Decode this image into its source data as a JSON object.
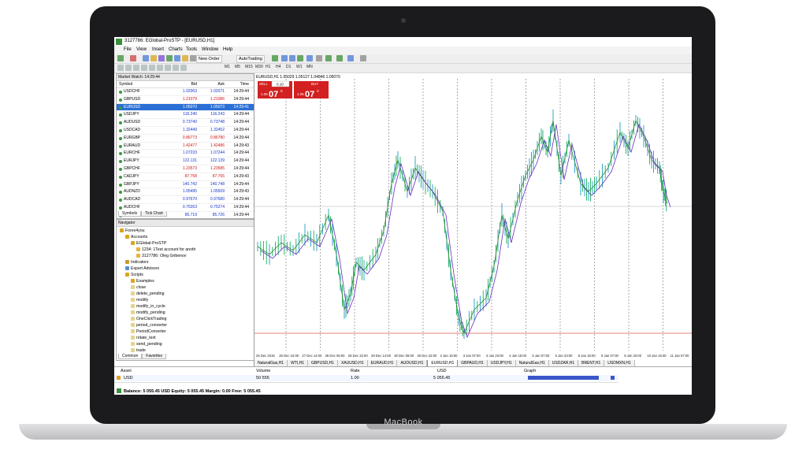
{
  "device": {
    "label": "MacBook"
  },
  "window": {
    "title": "3127786: EGlobal-ProSTP - [EURUSD,H1]"
  },
  "menu": [
    "File",
    "View",
    "Insert",
    "Charts",
    "Tools",
    "Window",
    "Help"
  ],
  "toolbar": {
    "new_order": "New Order",
    "autotrading": "AutoTrading"
  },
  "timeframes": [
    "M1",
    "M5",
    "M15",
    "M30",
    "H1",
    "H4",
    "D1",
    "W1",
    "MN"
  ],
  "market_watch": {
    "title": "Market Watch: 14:29:44",
    "columns": {
      "symbol": "Symbol",
      "bid": "Bid",
      "ask": "Ask",
      "time": "Time"
    },
    "rows": [
      {
        "symbol": "USDCHF",
        "bid": "1.02063",
        "ask": "1.02071",
        "time": "14:29:44",
        "color": "c-b"
      },
      {
        "symbol": "GBPUSD",
        "bid": "1.21079",
        "ask": "1.21086",
        "time": "14:29:44",
        "color": "c-r"
      },
      {
        "symbol": "EURUSD",
        "bid": "1.05070",
        "ask": "1.05073",
        "time": "14:29:41",
        "color": "c-b"
      },
      {
        "symbol": "USDJPY",
        "bid": "116.240",
        "ask": "116.243",
        "time": "14:29:44",
        "color": "c-b"
      },
      {
        "symbol": "AUDUSD",
        "bid": "0.73740",
        "ask": "0.73748",
        "time": "14:29:44",
        "color": "c-b"
      },
      {
        "symbol": "USDCAD",
        "bid": "1.32449",
        "ask": "1.32452",
        "time": "14:29:44",
        "color": "c-b"
      },
      {
        "symbol": "EURGBP",
        "bid": "0.86773",
        "ask": "0.86780",
        "time": "14:29:44",
        "color": "c-r"
      },
      {
        "symbol": "EURAUD",
        "bid": "1.42477",
        "ask": "1.42486",
        "time": "14:29:43",
        "color": "c-r"
      },
      {
        "symbol": "EURCHF",
        "bid": "1.07233",
        "ask": "1.07244",
        "time": "14:29:44",
        "color": "c-b"
      },
      {
        "symbol": "EURJPY",
        "bid": "122.131",
        "ask": "122.139",
        "time": "14:29:44",
        "color": "c-b"
      },
      {
        "symbol": "GBPCHF",
        "bid": "1.23573",
        "ask": "1.23585",
        "time": "14:29:44",
        "color": "c-r"
      },
      {
        "symbol": "CADJPY",
        "bid": "87.758",
        "ask": "87.765",
        "time": "14:29:43",
        "color": "c-r"
      },
      {
        "symbol": "GBPJPY",
        "bid": "140.742",
        "ask": "140.748",
        "time": "14:29:44",
        "color": "c-b"
      },
      {
        "symbol": "AUDNZD",
        "bid": "1.05495",
        "ask": "1.05509",
        "time": "14:29:43",
        "color": "c-b"
      },
      {
        "symbol": "AUDCAD",
        "bid": "0.97670",
        "ask": "0.97680",
        "time": "14:29:44",
        "color": "c-b"
      },
      {
        "symbol": "AUDCHF",
        "bid": "0.75263",
        "ask": "0.75274",
        "time": "14:29:44",
        "color": "c-b"
      },
      {
        "symbol": "AUDJPY",
        "bid": "85.719",
        "ask": "85.726",
        "time": "14:29:44",
        "color": "c-b"
      },
      {
        "symbol": "CHFJPY",
        "bid": "113.884",
        "ask": "113.888",
        "time": "14:29:44",
        "color": "c-b"
      }
    ],
    "tabs": [
      "Symbols",
      "Tick Chart"
    ]
  },
  "navigator": {
    "title": "Navigator",
    "items": [
      {
        "label": "Forex4you",
        "level": 0,
        "color": "#d9a520"
      },
      {
        "label": "Accounts",
        "level": 1,
        "color": "#d9a520"
      },
      {
        "label": "EGlobal-ProSTP",
        "level": 2,
        "color": "#d9a520"
      },
      {
        "label": "1234: 1Test account for anoth",
        "level": 3,
        "color": "#e8b23a"
      },
      {
        "label": "3127786: Oleg Gribenov",
        "level": 3,
        "color": "#e8b23a"
      },
      {
        "label": "Indicators",
        "level": 1,
        "color": "#c79a2e"
      },
      {
        "label": "Expert Advisors",
        "level": 1,
        "color": "#5a8dd6"
      },
      {
        "label": "Scripts",
        "level": 1,
        "color": "#d9a520"
      },
      {
        "label": "Examples",
        "level": 2,
        "color": "#d9a520"
      },
      {
        "label": "close",
        "level": 2,
        "color": "#e6d28a"
      },
      {
        "label": "delete_pending",
        "level": 2,
        "color": "#e6d28a"
      },
      {
        "label": "modify",
        "level": 2,
        "color": "#e6d28a"
      },
      {
        "label": "modify_in_cycle",
        "level": 2,
        "color": "#e6d28a"
      },
      {
        "label": "modify_pending",
        "level": 2,
        "color": "#e6d28a"
      },
      {
        "label": "OneClickTrading",
        "level": 2,
        "color": "#e6d28a"
      },
      {
        "label": "period_converter",
        "level": 2,
        "color": "#e6d28a"
      },
      {
        "label": "PeriodConverter",
        "level": 2,
        "color": "#e6d28a"
      },
      {
        "label": "rotate_text",
        "level": 2,
        "color": "#e6d28a"
      },
      {
        "label": "send_pending",
        "level": 2,
        "color": "#e6d28a"
      },
      {
        "label": "trade",
        "level": 2,
        "color": "#e6d28a"
      }
    ],
    "tabs": [
      "Common",
      "Favorites"
    ]
  },
  "chart": {
    "header": "EURUSD,H1  1.05029 1.05127 1.04846 1.05070",
    "one_click": {
      "sell": "SELL",
      "buy": "BUY",
      "lot": "0.10",
      "sell_big": "07",
      "sell_sup": "0",
      "sell_small": "1.05",
      "buy_big": "07",
      "buy_sup": "3",
      "buy_small": "1.05"
    },
    "xlabels": [
      "26 Dec 2016",
      "26 Dec 22:00",
      "27 Dec 14:00",
      "28 Dec 06:00",
      "28 Dec 22:00",
      "29 Dec 14:00",
      "30 Dec 06:00",
      "30 Dec 22:00",
      "2 Jan 15:00",
      "3 Jan 07:00",
      "3 Jan 23:00",
      "4 Jan 15:00",
      "5 Jan 07:00",
      "5 Jan 23:00",
      "6 Jan 15:00",
      "9 Jan 07:00",
      "9 Jan 23:00",
      "10 Jan 15:00",
      "11 Jan 07:00"
    ],
    "tabs": [
      "NaturalGas,H1",
      "WTI,H1",
      "GBPUSD,H1",
      "XAUUSD,H1",
      "EURAUD,H1",
      "AUDUSD,H1",
      "EURUSD,H1",
      "GBPAUD,H1",
      "USDJPY,H1",
      "NaturalGas,H1",
      "USDZAR,H1",
      "BRENT,H1",
      "USDMXN,H1"
    ],
    "active_tab": 6
  },
  "assets": {
    "columns": {
      "asset": "Asset",
      "volume": "Volume",
      "rate": "Rate",
      "usd": "USD",
      "graph": "Graph"
    },
    "row": {
      "asset": "USD",
      "volume": "50 555",
      "rate": "1.00",
      "usd": "5 055.45"
    },
    "status": "Balance: 5 055.45 USD  Equity: 5 055.45  Margin: 0.00  Free: 5 055.45"
  }
}
